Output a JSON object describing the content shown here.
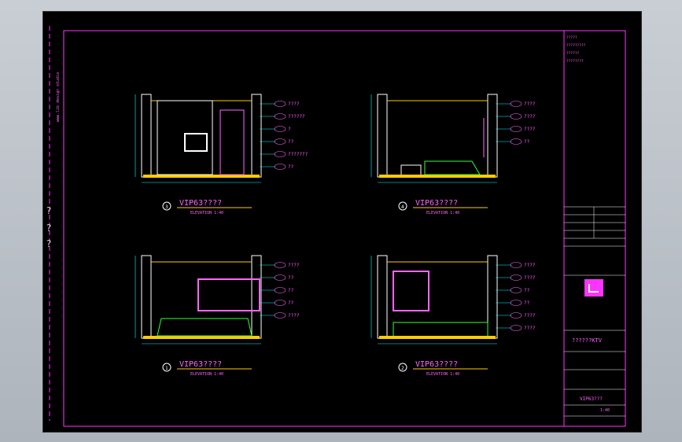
{
  "colors": {
    "frame": "#ff33ff",
    "wall": "#ffffff",
    "dim": "#00ffff",
    "floor": "#ffcc00",
    "green": "#33ff33",
    "text": "#ff66ff"
  },
  "side_marks": [
    "?",
    "?",
    "?"
  ],
  "elevations": [
    {
      "title": "VIP63????",
      "sub": "ELEVATION 1:40",
      "num": "3",
      "labels": [
        "????",
        "??????",
        "?",
        "??",
        "???????",
        "??"
      ]
    },
    {
      "title": "VIP63????",
      "sub": "ELEVATION 1:40",
      "num": "4",
      "labels": [
        "????",
        "????",
        "????",
        "??"
      ]
    },
    {
      "title": "VIP63????",
      "sub": "ELEVATION 1:40",
      "num": "1",
      "labels": [
        "????",
        "??",
        "??",
        "??",
        "????"
      ]
    },
    {
      "title": "VIP63????",
      "sub": "ELEVATION 1:40",
      "num": "2",
      "labels": [
        "????",
        "????",
        "??",
        "??",
        "????",
        "????"
      ]
    }
  ],
  "title_block": {
    "notes": [
      "?????",
      "?????????",
      "??????",
      "????????"
    ],
    "project": "??????KTV",
    "drawing": "VIP63???",
    "scale": "1:40"
  }
}
